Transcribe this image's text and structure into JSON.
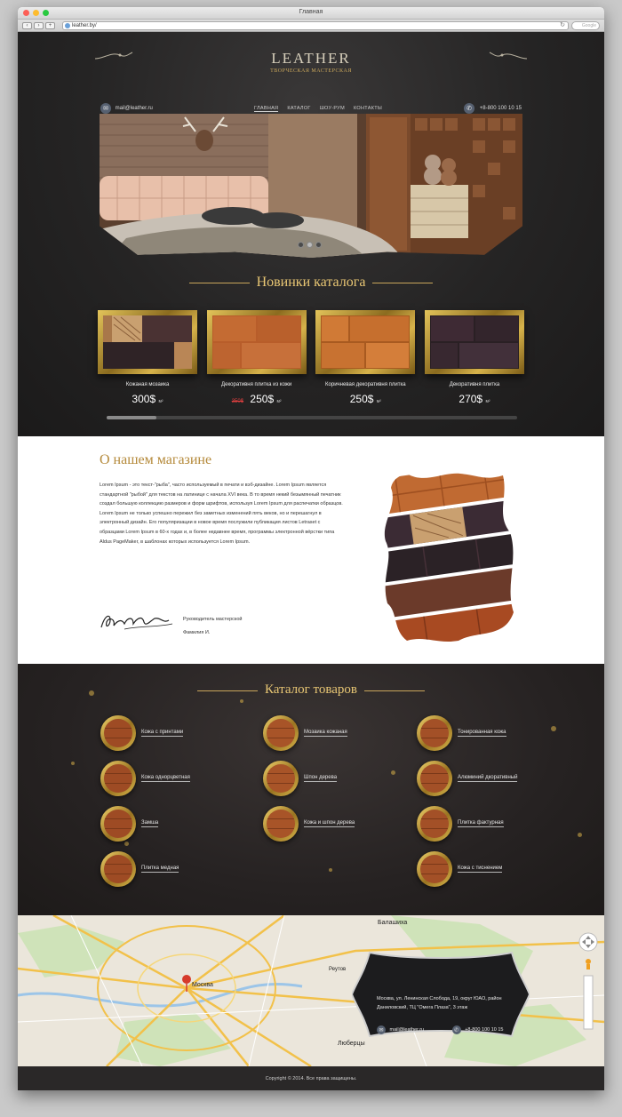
{
  "browser": {
    "window_title": "Главная",
    "url": "leather.by/",
    "search_placeholder": "Google"
  },
  "header": {
    "logo_title": "LEATHER",
    "logo_subtitle": "ТВОРЧЕСКАЯ МАСТЕРСКАЯ",
    "email": "mail@leather.ru",
    "phone": "+8-800 100 10 15",
    "nav": [
      "ГЛАВНАЯ",
      "КАТАЛОГ",
      "ШОУ-РУМ",
      "КОНТАКТЫ"
    ]
  },
  "new_products": {
    "title": "Новинки каталога",
    "items": [
      {
        "name": "Кожаная мозаика",
        "price": "300$",
        "old_price": "",
        "unit": "м²"
      },
      {
        "name": "Декоративня плитка из кожи",
        "price": "250$",
        "old_price": "350$",
        "unit": "м²"
      },
      {
        "name": "Коричневая декоративня плитка",
        "price": "250$",
        "old_price": "",
        "unit": "м²"
      },
      {
        "name": "Декоративня плитка",
        "price": "270$",
        "old_price": "",
        "unit": "м²"
      }
    ]
  },
  "about": {
    "title": "О нашем магазине",
    "text": "Lorem Ipsum - это текст-\"рыба\", часто используемый в печати и вэб-дизайне. Lorem Ipsum является стандартной \"рыбой\" для текстов на латинице с начала XVI века. В то время некий безымянный печатник создал большую коллекцию размеров и форм шрифтов, используя Lorem Ipsum для распечатки образцов. Lorem Ipsum не только успешно пережил без заметных изменений пять веков, но и перешагнул в электронный дизайн. Его популяризации в новое время послужили публикация листов Letraset с образцами Lorem Ipsum в 60-х годах и, в более недавнее время, программы электронной вёрстки типа Aldus PageMaker, в шаблонах которых используется Lorem Ipsum.",
    "role": "Руководитель мастерской",
    "person": "Фамилия И."
  },
  "catalog": {
    "title": "Каталог товаров",
    "items": [
      "Кожа с принтами",
      "Мозаика кожаная",
      "Тонированная кожа",
      "Кожа однорцветная",
      "Шпон дерева",
      "Алюминий дкоративный",
      "Замша",
      "Кожа и шпон дерева",
      "Плитка фактурная",
      "Плитка медная",
      "Кожа с тиснением"
    ]
  },
  "map": {
    "address": "Москва, ул. Ленинская Слобода, 19, округ ЮАО, район Даниловский, ТЦ \"Омега Плаза\", 3 этаж",
    "email": "mail@leather.ru",
    "phone": "+8-800 100 10 15",
    "labels": [
      "Москва",
      "Балашиха",
      "Реутов",
      "Люберцы"
    ]
  },
  "footer": {
    "copyright": "Copyright © 2014. Все права защищены."
  },
  "colors": {
    "gold": "#c9a65b",
    "title_gold": "#e9c774",
    "old_price": "#e14040"
  }
}
